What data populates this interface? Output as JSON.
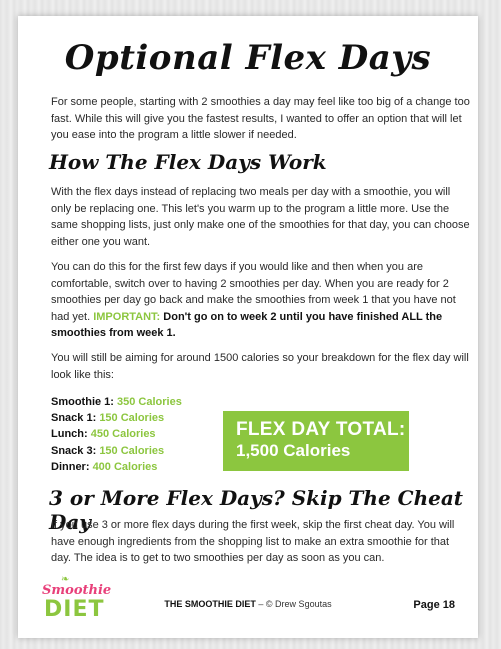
{
  "title": "Optional Flex Days",
  "intro": "For some people, starting with 2 smoothies a day may feel like too big of a change too fast. While this will give you the fastest results, I wanted to offer an option that will let you ease into the program a little slower if needed.",
  "section1": {
    "heading": "How The Flex Days Work",
    "para1": "With the flex days instead of replacing two meals per day with a smoothie, you will only be replacing one. This let's you warm up to the program a little more. Use the same shopping lists, just only make one of the smoothies for that day, you can choose either one you want.",
    "para2_text": "You can do this for the first few days if you would like and then when you are comfortable, switch over to having 2 smoothies per day. When you are ready for 2 smoothies per day go back and make the smoothies from week 1 that you have not had yet. ",
    "para2_important": "IMPORTANT:",
    "para2_bold": " Don't go on to week 2 until you have finished ALL the smoothies from week 1.",
    "para3": "You will still be aiming for around 1500 calories so your breakdown for the flex day will look like this:"
  },
  "breakdown": [
    {
      "label": "Smoothie 1:",
      "value": "350 Calories"
    },
    {
      "label": "Snack 1:",
      "value": "150 Calories"
    },
    {
      "label": "Lunch:",
      "value": "450 Calories"
    },
    {
      "label": "Snack 3:",
      "value": "150 Calories"
    },
    {
      "label": "Dinner:",
      "value": "400 Calories"
    }
  ],
  "total": {
    "line1": "FLEX DAY TOTAL:",
    "line2": "1,500 Calories"
  },
  "section2": {
    "heading": "3 or More Flex Days? Skip The Cheat Day",
    "para": "If you use 3 or more flex days during the first week, skip the first cheat day. You will have enough ingredients from the shopping list to make an extra smoothie for that day. The idea is to get to two smoothies per day as soon as you can."
  },
  "logo": {
    "line1": "Smoothie",
    "line2": "DIET"
  },
  "footer": {
    "brand": "THE SMOOTHIE DIET",
    "credit": " – © Drew Sgoutas",
    "page": "Page 18"
  },
  "colors": {
    "accent_green": "#8cc63f",
    "logo_pink": "#e8407a"
  }
}
